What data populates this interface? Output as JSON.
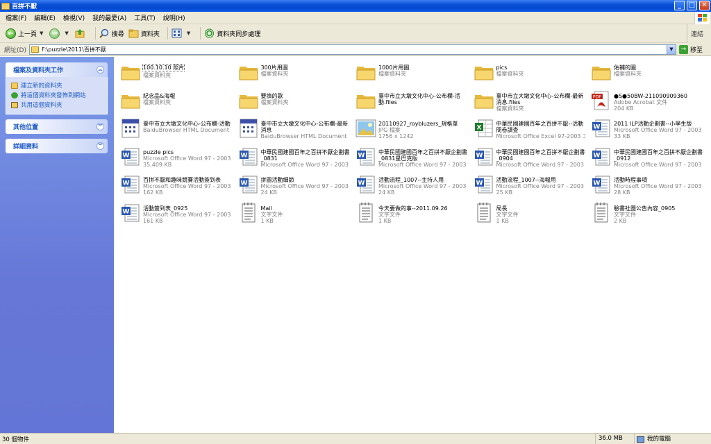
{
  "window": {
    "title": "百拼不厭"
  },
  "menu": [
    "檔案(F)",
    "編輯(E)",
    "檢視(V)",
    "我的最愛(A)",
    "工具(T)",
    "說明(H)"
  ],
  "toolbar": {
    "back": "上一頁",
    "search": "搜尋",
    "folders": "資料夾",
    "sync": "資料夾同步處理",
    "links": "連結"
  },
  "address": {
    "label": "網址(D)",
    "path": "F:\\puzzle\\2011\\百拼不厭",
    "go": "移至"
  },
  "sidebar": {
    "tasks_title": "檔案及資料夾工作",
    "tasks": [
      "建立新的資料夾",
      "將這個資料夾發佈到網站",
      "共用這個資料夾"
    ],
    "other_title": "其他位置",
    "details_title": "詳細資料"
  },
  "items": [
    {
      "name": "100.10.10 照片",
      "sub1": "檔案資料夾",
      "sub2": "",
      "icon": "folder",
      "selected": true
    },
    {
      "name": "300片用圖",
      "sub1": "檔案資料夾",
      "sub2": "",
      "icon": "folder"
    },
    {
      "name": "1000片用圖",
      "sub1": "檔案資料夾",
      "sub2": "",
      "icon": "folder"
    },
    {
      "name": "pics",
      "sub1": "檔案資料夾",
      "sub2": "",
      "icon": "folder"
    },
    {
      "name": "佑補的圖",
      "sub1": "檔案資料夾",
      "sub2": "",
      "icon": "folder"
    },
    {
      "name": "紀念品&海報",
      "sub1": "檔案資料夾",
      "sub2": "",
      "icon": "folder"
    },
    {
      "name": "要擠的歌",
      "sub1": "檔案資料夾",
      "sub2": "",
      "icon": "folder"
    },
    {
      "name": "臺中市立大墩文化中心-公布欄-活動.files",
      "sub1": "",
      "sub2": "",
      "icon": "folder"
    },
    {
      "name": "臺中市立大墩文化中心-公布欄-最新消息.files",
      "sub1": "檔案資料夾",
      "sub2": "",
      "icon": "folder"
    },
    {
      "name": "●S●50BW-211090909360",
      "sub1": "Adobe Acrobat 文件",
      "sub2": "204 KB",
      "icon": "pdf"
    },
    {
      "name": "臺中市立大墩文化中心-公布欄-活動",
      "sub1": "BaiduBrowser HTML Document",
      "sub2": "",
      "icon": "html"
    },
    {
      "name": "臺中市立大墩文化中心-公布欄-最新消息",
      "sub1": "BaiduBrowser HTML Document",
      "sub2": "",
      "icon": "html"
    },
    {
      "name": "20110927_roybluzers_規格單",
      "sub1": "JPG 檔案",
      "sub2": "1756 x 1242",
      "icon": "jpg"
    },
    {
      "name": "中華民國建國百年之百拼不厭--活動問卷調查",
      "sub1": "Microsoft Office Excel 97-2003 工...",
      "sub2": "",
      "icon": "excel"
    },
    {
      "name": "2011 ILP活動企劃書--小學生版",
      "sub1": "Microsoft Office Word 97 - 2003 ...",
      "sub2": "33 KB",
      "icon": "word"
    },
    {
      "name": "puzzle pics",
      "sub1": "Microsoft Office Word 97 - 2003 ...",
      "sub2": "35,409 KB",
      "icon": "word"
    },
    {
      "name": "中華民國建國百年之百拼不厭企劃書_0831",
      "sub1": "Microsoft Office Word 97 - 2003 ...",
      "sub2": "",
      "icon": "word"
    },
    {
      "name": "中華民國建國百年之百拼不厭企劃書_0831星巴克版",
      "sub1": "Microsoft Office Word 97 - 2003 ...",
      "sub2": "",
      "icon": "word"
    },
    {
      "name": "中華民國建國百年之百拼不厭企劃書_0904",
      "sub1": "Microsoft Office Word 97 - 2003 ...",
      "sub2": "",
      "icon": "word"
    },
    {
      "name": "中華民國建國百年之百拼不厭企劃書_0912",
      "sub1": "Microsoft Office Word 97 - 2003 ...",
      "sub2": "",
      "icon": "word"
    },
    {
      "name": "百拼不厭和趣味競賽活動簽到表",
      "sub1": "Microsoft Office Word 97 - 2003 ...",
      "sub2": "162 KB",
      "icon": "word"
    },
    {
      "name": "拼圖活動細節",
      "sub1": "Microsoft Office Word 97 - 2003 ...",
      "sub2": "24 KB",
      "icon": "word"
    },
    {
      "name": "活動流程_1007--主持人用",
      "sub1": "Microsoft Office Word 97 - 2003 ...",
      "sub2": "24 KB",
      "icon": "word"
    },
    {
      "name": "活動流程_1007--海報用",
      "sub1": "Microsoft Office Word 97 - 2003 ...",
      "sub2": "25 KB",
      "icon": "word"
    },
    {
      "name": "活動時程事項",
      "sub1": "Microsoft Office Word 97 - 2003 ...",
      "sub2": "28 KB",
      "icon": "word"
    },
    {
      "name": "活動簽到表_0925",
      "sub1": "Microsoft Office Word 97 - 2003 ...",
      "sub2": "161 KB",
      "icon": "word"
    },
    {
      "name": "Mail",
      "sub1": "文字文件",
      "sub2": "1 KB",
      "icon": "txt"
    },
    {
      "name": "今天要做的事--2011.09.26",
      "sub1": "文字文件",
      "sub2": "1 KB",
      "icon": "txt"
    },
    {
      "name": "局長",
      "sub1": "文字文件",
      "sub2": "1 KB",
      "icon": "txt"
    },
    {
      "name": "驗書社團公告內容_0905",
      "sub1": "文字文件",
      "sub2": "2 KB",
      "icon": "txt"
    }
  ],
  "status": {
    "count": "30 個物件",
    "size": "36.0 MB",
    "location": "我的電腦"
  }
}
